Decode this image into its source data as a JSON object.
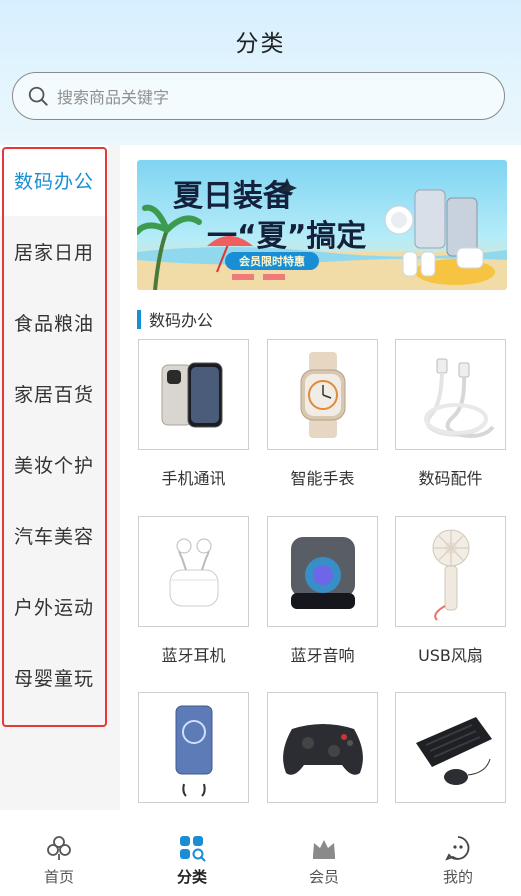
{
  "header": {
    "title": "分类",
    "search_placeholder": "搜索商品关键字"
  },
  "sidebar": {
    "items": [
      {
        "label": "数码办公",
        "active": true
      },
      {
        "label": "居家日用",
        "active": false
      },
      {
        "label": "食品粮油",
        "active": false
      },
      {
        "label": "家居百货",
        "active": false
      },
      {
        "label": "美妆个护",
        "active": false
      },
      {
        "label": "汽车美容",
        "active": false
      },
      {
        "label": "户外运动",
        "active": false
      },
      {
        "label": "母婴童玩",
        "active": false
      }
    ]
  },
  "banner": {
    "headline_1": "夏日装备",
    "headline_2": "一“夏”搞定",
    "tag": "会员限时特惠"
  },
  "section": {
    "title": "数码办公"
  },
  "products": [
    {
      "label": "手机通讯",
      "icon": "phone"
    },
    {
      "label": "智能手表",
      "icon": "watch"
    },
    {
      "label": "数码配件",
      "icon": "cable"
    },
    {
      "label": "蓝牙耳机",
      "icon": "earbuds"
    },
    {
      "label": "蓝牙音响",
      "icon": "speaker"
    },
    {
      "label": "USB风扇",
      "icon": "fan"
    },
    {
      "label": "",
      "icon": "power-bank"
    },
    {
      "label": "",
      "icon": "gamepad"
    },
    {
      "label": "",
      "icon": "keyboard-mouse"
    }
  ],
  "tabbar": {
    "items": [
      {
        "label": "首页",
        "icon": "home-icon",
        "active": false
      },
      {
        "label": "分类",
        "icon": "category-icon",
        "active": true
      },
      {
        "label": "会员",
        "icon": "crown-icon",
        "active": false
      },
      {
        "label": "我的",
        "icon": "profile-icon",
        "active": false
      }
    ]
  },
  "colors": {
    "accent": "#1a8ed4",
    "highlight_frame": "#e53935",
    "sidebar_bg": "#f5f5f5"
  }
}
